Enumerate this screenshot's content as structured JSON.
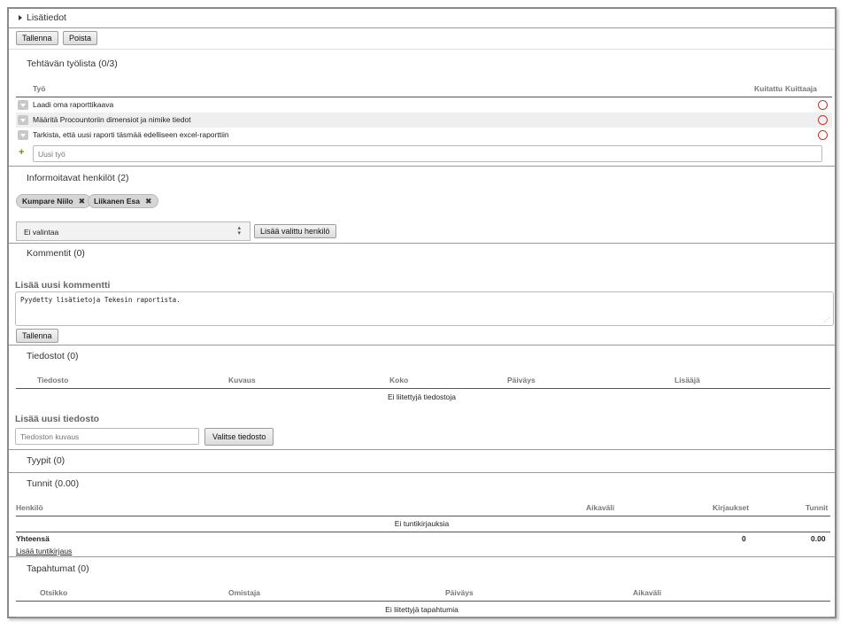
{
  "header": {
    "title": "Lisätiedot"
  },
  "toolbar": {
    "save_label": "Tallenna",
    "delete_label": "Poista"
  },
  "worklist": {
    "title": "Tehtävän työlista (0/3)",
    "columns": {
      "work": "Työ",
      "acknowledged": "Kuitattu",
      "acknowledger": "Kuittaaja"
    },
    "items": [
      {
        "label": "Laadi oma raporttikaava"
      },
      {
        "label": "Määritä Procountoriin dimensiot ja nimike tiedot"
      },
      {
        "label": "Tarkista, että uusi raporti täsmää edelliseen excel-raporttiin"
      }
    ],
    "new_placeholder": "Uusi työ"
  },
  "informed": {
    "title": "Informoitavat henkilöt (2)",
    "people": [
      {
        "name": "Kumpare Niilo"
      },
      {
        "name": "Liikanen Esa"
      }
    ],
    "select_value": "Ei valintaa",
    "add_label": "Lisää valittu henkilö"
  },
  "comments": {
    "title": "Kommentit (0)",
    "add_heading": "Lisää uusi kommentti",
    "draft": "Pyydetty lisätietoja Tekesin raportista.",
    "save_label": "Tallenna"
  },
  "files": {
    "title": "Tiedostot (0)",
    "columns": {
      "file": "Tiedosto",
      "description": "Kuvaus",
      "size": "Koko",
      "date": "Päiväys",
      "adder": "Lisääjä"
    },
    "empty": "Ei liitettyjä tiedostoja",
    "add_heading": "Lisää uusi tiedosto",
    "description_placeholder": "Tiedoston kuvaus",
    "choose_label": "Valitse tiedosto"
  },
  "types": {
    "title": "Tyypit (0)"
  },
  "hours": {
    "title": "Tunnit (0.00)",
    "columns": {
      "person": "Henkilö",
      "interval": "Aikaväli",
      "entries": "Kirjaukset",
      "hours": "Tunnit"
    },
    "empty": "Ei tuntikirjauksia",
    "total_label": "Yhteensä",
    "total_entries": "0",
    "total_hours": "0.00",
    "add_link": "Lisää tuntikirjaus"
  },
  "events": {
    "title": "Tapahtumat (0)",
    "columns": {
      "title": "Otsikko",
      "owner": "Omistaja",
      "date": "Päiväys",
      "interval": "Aikaväli"
    },
    "empty": "Ei liitettyjä tapahtumia"
  },
  "colors": {
    "danger": "#c0392b",
    "border": "#9a9a9a"
  }
}
